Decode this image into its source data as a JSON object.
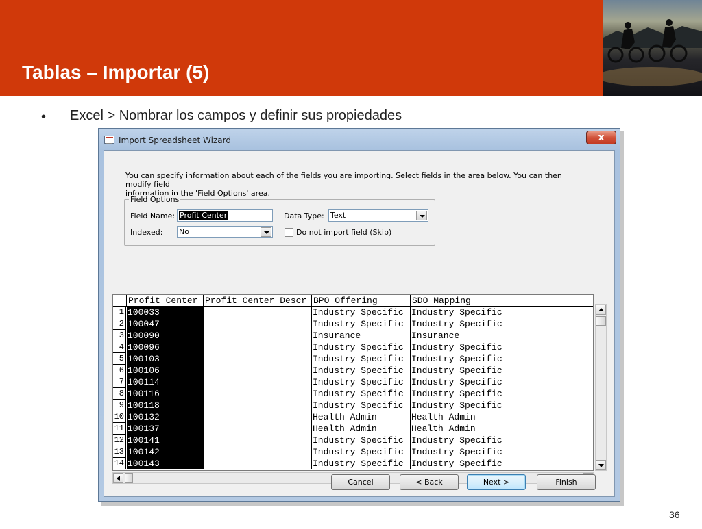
{
  "slide": {
    "title": "Tablas – Importar (5)",
    "bullet_symbol": "•",
    "bullet": "Excel > Nombrar los campos y definir sus propiedades",
    "page_number": "36",
    "accent_color": "#d0390a"
  },
  "window": {
    "title": "Import Spreadsheet Wizard",
    "close_glyph": "x",
    "intro_line1": "You can specify information about each of the fields you are importing.  Select fields in the area below. You can then modify field",
    "intro_line2": "information in the 'Field Options' area.",
    "field_options": {
      "legend": "Field Options",
      "field_name_label": "Field Name:",
      "field_name_value": "Profit Center",
      "data_type_label": "Data Type:",
      "data_type_value": "Text",
      "indexed_label": "Indexed:",
      "indexed_value": "No",
      "skip_label": "Do not import field (Skip)"
    },
    "grid": {
      "columns": [
        "Profit Center",
        "Profit Center Descr",
        "BPO Offering",
        "SDO Mapping"
      ],
      "rows": [
        {
          "num": "1",
          "profit_center": "100033",
          "descr": "",
          "bpo": "Industry Specific",
          "sdo": "Industry Specific"
        },
        {
          "num": "2",
          "profit_center": "100047",
          "descr": "",
          "bpo": "Industry Specific",
          "sdo": "Industry Specific"
        },
        {
          "num": "3",
          "profit_center": "100090",
          "descr": "",
          "bpo": "Insurance",
          "sdo": "Insurance"
        },
        {
          "num": "4",
          "profit_center": "100096",
          "descr": "",
          "bpo": "Industry Specific",
          "sdo": "Industry Specific"
        },
        {
          "num": "5",
          "profit_center": "100103",
          "descr": "",
          "bpo": "Industry Specific",
          "sdo": "Industry Specific"
        },
        {
          "num": "6",
          "profit_center": "100106",
          "descr": "",
          "bpo": "Industry Specific",
          "sdo": "Industry Specific"
        },
        {
          "num": "7",
          "profit_center": "100114",
          "descr": "",
          "bpo": "Industry Specific",
          "sdo": "Industry Specific"
        },
        {
          "num": "8",
          "profit_center": "100116",
          "descr": "",
          "bpo": "Industry Specific",
          "sdo": "Industry Specific"
        },
        {
          "num": "9",
          "profit_center": "100118",
          "descr": "",
          "bpo": "Industry Specific",
          "sdo": "Industry Specific"
        },
        {
          "num": "10",
          "profit_center": "100132",
          "descr": "",
          "bpo": "Health Admin",
          "sdo": "Health Admin"
        },
        {
          "num": "11",
          "profit_center": "100137",
          "descr": "",
          "bpo": "Health Admin",
          "sdo": "Health Admin"
        },
        {
          "num": "12",
          "profit_center": "100141",
          "descr": "",
          "bpo": "Industry Specific",
          "sdo": "Industry Specific"
        },
        {
          "num": "13",
          "profit_center": "100142",
          "descr": "",
          "bpo": "Industry Specific",
          "sdo": "Industry Specific"
        },
        {
          "num": "14",
          "profit_center": "100143",
          "descr": "",
          "bpo": "Industry Specific",
          "sdo": "Industry Specific"
        }
      ]
    },
    "buttons": {
      "cancel": "Cancel",
      "back": "< Back",
      "next": "Next >",
      "finish": "Finish"
    }
  }
}
